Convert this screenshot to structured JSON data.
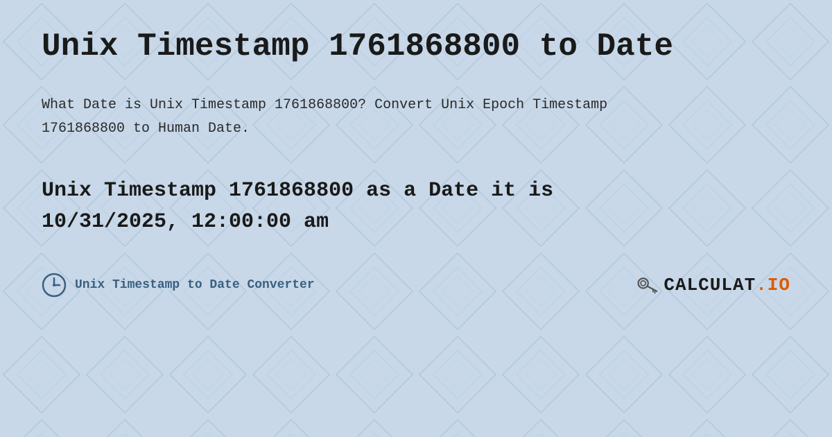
{
  "page": {
    "title": "Unix Timestamp 1761868800 to Date",
    "description": "What Date is Unix Timestamp 1761868800? Convert Unix Epoch Timestamp 1761868800 to Human Date.",
    "result": "Unix Timestamp 1761868800 as a Date it is 10/31/2025, 12:00:00 am",
    "footer_link": "Unix Timestamp to Date Converter",
    "logo_text": "CALCULAT.IO",
    "background_color": "#c8d8e8",
    "accent_color": "#3a6080",
    "text_color": "#1a1a1a"
  }
}
